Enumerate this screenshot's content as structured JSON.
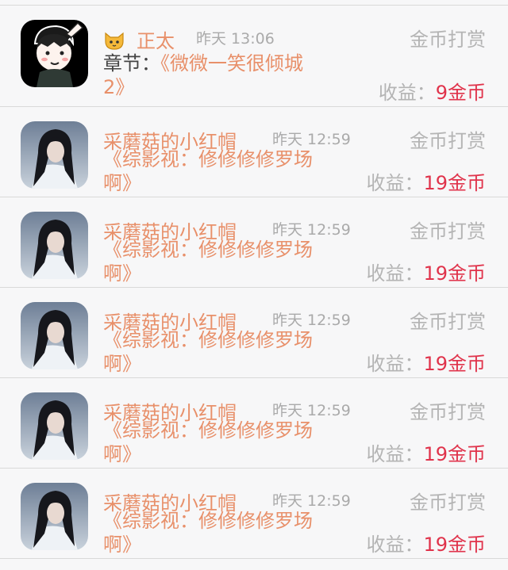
{
  "rows": [
    {
      "name": "正太",
      "time": "昨天 13:06",
      "tip": "金币打赏",
      "chapter_label": "章节：",
      "title_line1": "《微微一笑很倾城",
      "title_line2": "2》",
      "income_label": "收益：",
      "income_value": "9金币"
    },
    {
      "name": "采蘑菇的小红帽",
      "time": "昨天 12:59",
      "tip": "金币打赏",
      "title_line1": "《综影视：修修修修罗场",
      "title_line2": "啊》",
      "income_label": "收益：",
      "income_value": "19金币"
    },
    {
      "name": "采蘑菇的小红帽",
      "time": "昨天 12:59",
      "tip": "金币打赏",
      "title_line1": "《综影视：修修修修罗场",
      "title_line2": "啊》",
      "income_label": "收益：",
      "income_value": "19金币"
    },
    {
      "name": "采蘑菇的小红帽",
      "time": "昨天 12:59",
      "tip": "金币打赏",
      "title_line1": "《综影视：修修修修罗场",
      "title_line2": "啊》",
      "income_label": "收益：",
      "income_value": "19金币"
    },
    {
      "name": "采蘑菇的小红帽",
      "time": "昨天 12:59",
      "tip": "金币打赏",
      "title_line1": "《综影视：修修修修罗场",
      "title_line2": "啊》",
      "income_label": "收益：",
      "income_value": "19金币"
    },
    {
      "name": "采蘑菇的小红帽",
      "time": "昨天 12:59",
      "tip": "金币打赏",
      "title_line1": "《综影视：修修修修罗场",
      "title_line2": "啊》",
      "income_label": "收益：",
      "income_value": "19金币"
    }
  ],
  "icons": {
    "row0_name_icon": "cat-face-icon",
    "row0_avatar": "cartoon-boy-avatar",
    "row_avatar": "dark-haired-character-avatar"
  },
  "colors": {
    "name": "#e8906a",
    "muted": "#aaaaaa",
    "amount": "#e0334b"
  }
}
